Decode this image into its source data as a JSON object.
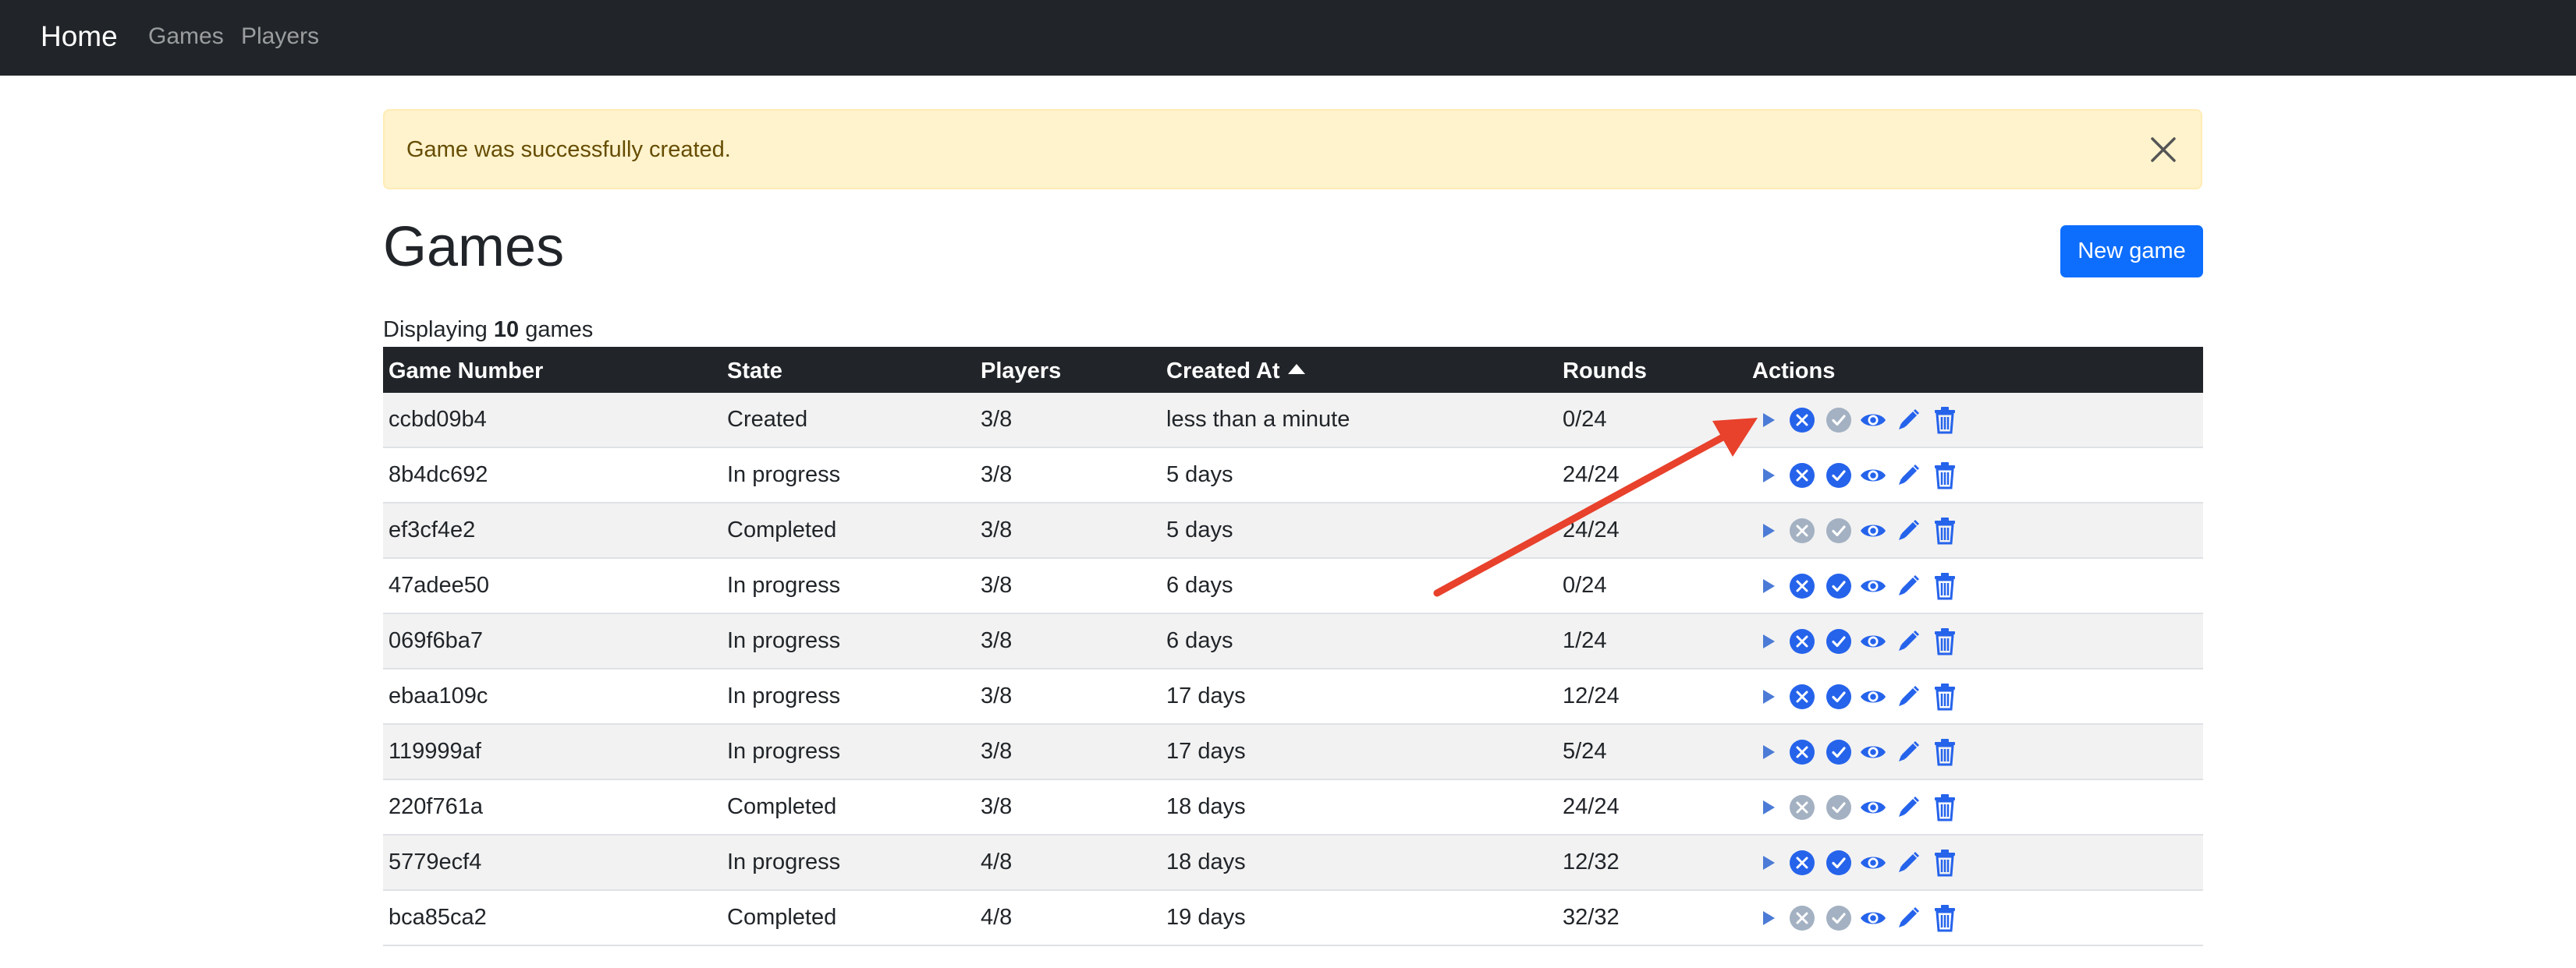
{
  "nav": {
    "brand": "Home",
    "links": [
      {
        "label": "Games"
      },
      {
        "label": "Players"
      }
    ]
  },
  "alert": {
    "message": "Game was successfully created.",
    "close_icon": "close-icon"
  },
  "page": {
    "title": "Games",
    "new_button": "New game",
    "count_prefix": "Displaying",
    "count_value": "10",
    "count_suffix": "games"
  },
  "table": {
    "headers": {
      "game_number": "Game Number",
      "state": "State",
      "players": "Players",
      "created_at": "Created At",
      "rounds": "Rounds",
      "actions": "Actions"
    },
    "sort_icon": "sort-ascending-icon",
    "rows": [
      {
        "game": "ccbd09b4",
        "state": "Created",
        "players": "3/8",
        "created": "less than a minute",
        "rounds": "0/24",
        "cancel_enabled": true,
        "complete_enabled": false
      },
      {
        "game": "8b4dc692",
        "state": "In progress",
        "players": "3/8",
        "created": "5 days",
        "rounds": "24/24",
        "cancel_enabled": true,
        "complete_enabled": true
      },
      {
        "game": "ef3cf4e2",
        "state": "Completed",
        "players": "3/8",
        "created": "5 days",
        "rounds": "24/24",
        "cancel_enabled": false,
        "complete_enabled": false
      },
      {
        "game": "47adee50",
        "state": "In progress",
        "players": "3/8",
        "created": "6 days",
        "rounds": "0/24",
        "cancel_enabled": true,
        "complete_enabled": true
      },
      {
        "game": "069f6ba7",
        "state": "In progress",
        "players": "3/8",
        "created": "6 days",
        "rounds": "1/24",
        "cancel_enabled": true,
        "complete_enabled": true
      },
      {
        "game": "ebaa109c",
        "state": "In progress",
        "players": "3/8",
        "created": "17 days",
        "rounds": "12/24",
        "cancel_enabled": true,
        "complete_enabled": true
      },
      {
        "game": "119999af",
        "state": "In progress",
        "players": "3/8",
        "created": "17 days",
        "rounds": "5/24",
        "cancel_enabled": true,
        "complete_enabled": true
      },
      {
        "game": "220f761a",
        "state": "Completed",
        "players": "3/8",
        "created": "18 days",
        "rounds": "24/24",
        "cancel_enabled": false,
        "complete_enabled": false
      },
      {
        "game": "5779ecf4",
        "state": "In progress",
        "players": "4/8",
        "created": "18 days",
        "rounds": "12/32",
        "cancel_enabled": true,
        "complete_enabled": true
      },
      {
        "game": "bca85ca2",
        "state": "Completed",
        "players": "4/8",
        "created": "19 days",
        "rounds": "32/32",
        "cancel_enabled": false,
        "complete_enabled": false
      }
    ]
  },
  "action_icons": [
    "play-icon",
    "cancel-icon",
    "complete-icon",
    "view-icon",
    "edit-icon",
    "delete-icon"
  ],
  "colors": {
    "navbar": "#212529",
    "primary": "#0d6efd",
    "action_blue": "#2563eb",
    "disabled": "#a3b1c2",
    "alert_bg": "#fff3cd",
    "alert_text": "#664d03",
    "annotation_arrow": "#e8412c"
  }
}
